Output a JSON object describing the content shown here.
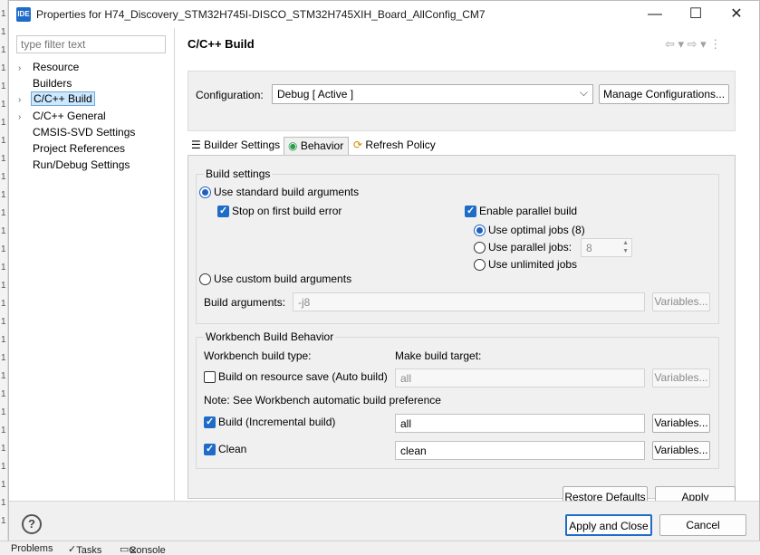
{
  "window": {
    "icon_text": "IDE",
    "title": "Properties for H74_Discovery_STM32H745I-DISCO_STM32H745XIH_Board_AllConfig_CM7",
    "minimize": "—",
    "maximize": "☐",
    "close": "✕"
  },
  "sidebar": {
    "filter_placeholder": "type filter text",
    "items": [
      {
        "label": "Resource",
        "arrow": "›"
      },
      {
        "label": "Builders",
        "arrow": ""
      },
      {
        "label": "C/C++ Build",
        "arrow": "›"
      },
      {
        "label": "C/C++ General",
        "arrow": "›"
      },
      {
        "label": "CMSIS-SVD Settings",
        "arrow": ""
      },
      {
        "label": "Project References",
        "arrow": ""
      },
      {
        "label": "Run/Debug Settings",
        "arrow": ""
      }
    ]
  },
  "main": {
    "title": "C/C++ Build",
    "nav_icons": "⇦ ▾ ⇨ ▾ ⋮",
    "configuration_label": "Configuration:",
    "configuration_value": "Debug  [ Active ]",
    "combo_chevron": "⌵",
    "manage_button": "Manage Configurations...",
    "tabs": [
      {
        "icon": "☰",
        "label": "Builder Settings"
      },
      {
        "icon": "◉",
        "label": "Behavior"
      },
      {
        "icon": "⟳",
        "label": "Refresh Policy"
      }
    ]
  },
  "build_settings": {
    "group_title": "Build settings",
    "use_standard": "Use standard build arguments",
    "stop_on_first_error": "Stop on first build error",
    "enable_parallel": "Enable parallel build",
    "use_optimal_jobs": "Use optimal jobs (8)",
    "use_parallel_jobs": "Use parallel jobs:",
    "parallel_jobs_value": "8",
    "use_unlimited_jobs": "Use unlimited jobs",
    "use_custom": "Use custom build arguments",
    "build_arguments_label": "Build arguments:",
    "build_arguments_value": "-j8",
    "variables_button": "Variables..."
  },
  "workbench": {
    "group_title": "Workbench Build Behavior",
    "build_type_label": "Workbench build type:",
    "make_target_label": "Make build target:",
    "auto_build_label": "Build on resource save (Auto build)",
    "auto_build_target": "all",
    "note": "Note: See Workbench automatic build preference",
    "incremental_label": "Build (Incremental build)",
    "incremental_target": "all",
    "clean_label": "Clean",
    "clean_target": "clean",
    "variables_button": "Variables..."
  },
  "page_buttons": {
    "restore_defaults": "Restore Defaults",
    "apply": "Apply"
  },
  "footer": {
    "help": "?",
    "apply_close": "Apply and Close",
    "cancel": "Cancel"
  },
  "background_strip": {
    "problems": "Problems",
    "tasks": "Tasks",
    "console": "Console",
    "close": "✕"
  },
  "colors": {
    "accent": "#1f6cc8",
    "panel_bg": "#f0f0f0",
    "selection": "#cce8ff"
  }
}
